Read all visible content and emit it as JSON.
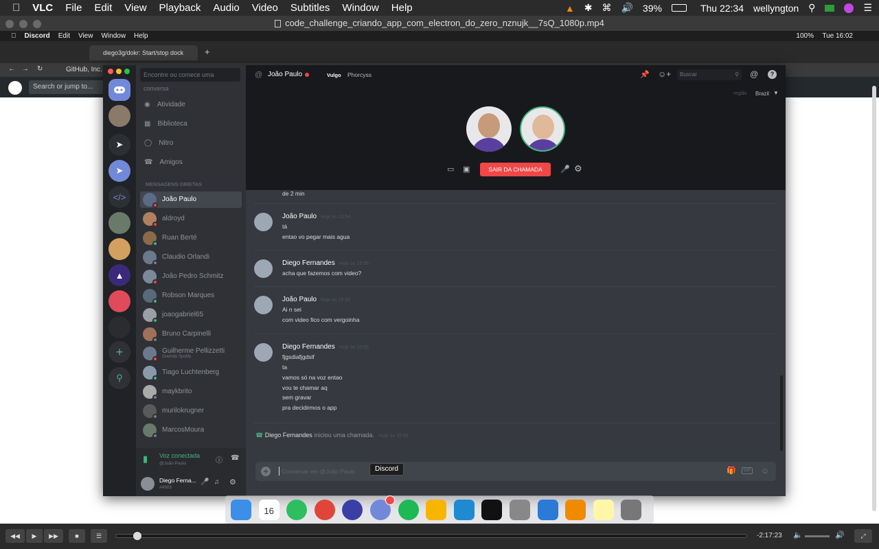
{
  "vlc": {
    "app": "VLC",
    "menus": [
      "File",
      "Edit",
      "View",
      "Playback",
      "Audio",
      "Video",
      "Subtitles",
      "Window",
      "Help"
    ],
    "battery": "39%",
    "datetime": "Thu 22:34",
    "user": "wellyngton",
    "file_title": "code_challenge_criando_app_com_electron_do_zero_nznujk__7sQ_1080p.mp4",
    "time_remaining": "-2:17:23"
  },
  "inner": {
    "app": "Discord",
    "menus": [
      "Edit",
      "View",
      "Window",
      "Help"
    ],
    "battery": "100%",
    "clock": "Tue 16:02",
    "tab_title": "diego3g/dokr: Start/stop dock",
    "address": "GitHub, Inc.",
    "gh_search": "Search or jump to..."
  },
  "dm": {
    "search_placeholder": "Encontre ou comece uma conversa",
    "nav": [
      "Atividade",
      "Biblioteca",
      "Nitro",
      "Amigos"
    ],
    "section_title": "MENSAGENS DIRETAS",
    "users": [
      {
        "name": "João Paulo",
        "status": "#f04747",
        "color": "#5b6a86"
      },
      {
        "name": "aldroyd",
        "status": "#f04747",
        "color": "#b08060"
      },
      {
        "name": "Ruan Berté",
        "status": "#43b581",
        "color": "#8a6a4a"
      },
      {
        "name": "Claudio Orlandi",
        "status": "#747f8d",
        "color": "#6a7a8a"
      },
      {
        "name": "João Pedro Schmitz",
        "status": "#f04747",
        "color": "#7a8a9a"
      },
      {
        "name": "Robson Marques",
        "status": "#43b581",
        "color": "#5a6a7a"
      },
      {
        "name": "joaogabriel65",
        "status": "#43b581",
        "color": "#9aa0a6"
      },
      {
        "name": "Bruno Carpinelli",
        "status": "#747f8d",
        "color": "#a0705a"
      },
      {
        "name": "Guilherme Pellizzetti",
        "sub": "Ouvindo Spotify",
        "status": "#f04747",
        "color": "#6a7a8a"
      },
      {
        "name": "Tiago Luchtenberg",
        "status": "#43b581",
        "color": "#8a9aaa"
      },
      {
        "name": "maykbrito",
        "status": "#747f8d",
        "color": "#aaaaaa"
      },
      {
        "name": "murilokrugner",
        "status": "#747f8d",
        "color": "#5a5a5a"
      },
      {
        "name": "MarcosMoura",
        "status": "#747f8d",
        "color": "#6a7a6a"
      }
    ],
    "voice_status": "Voz conectada",
    "voice_sub": "@João Paulo",
    "me_name": "Diego Ferna...",
    "me_tag": "#4903"
  },
  "chat": {
    "header_name": "João Paulo",
    "vulgo": "Vulgo",
    "nick": "Phorcyss",
    "search": "Buscar",
    "region_label": "região",
    "region": "Brazil",
    "leave_call": "SAIR DA CHAMADA",
    "partial_top": "de 2 min",
    "messages": [
      {
        "author": "João Paulo",
        "time": "Hoje às 15:54",
        "lines": [
          "tá",
          "entao vo pegar mais agua"
        ]
      },
      {
        "author": "Diego Fernandes",
        "time": "Hoje às 15:55",
        "lines": [
          "acha que fazemos com video?"
        ]
      },
      {
        "author": "João Paulo",
        "time": "Hoje às 15:55",
        "lines": [
          "Ai n sei",
          "com video fico com vergoinha"
        ]
      },
      {
        "author": "Diego Fernandes",
        "time": "Hoje às 15:55",
        "lines": [
          "fjgsdiafjgdsif",
          "ta",
          "vamos só na voz entao",
          "vou te chamar aq",
          "sem gravar",
          "pra decidirmos o app"
        ]
      }
    ],
    "call_author": "Diego Fernandes",
    "call_text": "iniciou uma chamada.",
    "call_time": "Hoje às 15:56",
    "composer_placeholder": "Conversar em @João Paulo"
  },
  "dock": {
    "tooltip": "Discord",
    "badge": "",
    "icons": [
      {
        "name": "finder",
        "color": "#3b8fe6"
      },
      {
        "name": "calendar",
        "color": "#ffffff",
        "label": "16"
      },
      {
        "name": "evernote",
        "color": "#2dbe60"
      },
      {
        "name": "chrome",
        "color": "#e0453a"
      },
      {
        "name": "alto",
        "color": "#3a3fa8"
      },
      {
        "name": "discord",
        "color": "#7289da"
      },
      {
        "name": "spotify",
        "color": "#1db954"
      },
      {
        "name": "sketch",
        "color": "#f7b500"
      },
      {
        "name": "vscode",
        "color": "#1f8ad2"
      },
      {
        "name": "terminal",
        "color": "#111111"
      },
      {
        "name": "photos",
        "color": "#888888"
      },
      {
        "name": "xcode-app",
        "color": "#2a7ad6"
      },
      {
        "name": "vlc",
        "color": "#f08a00"
      },
      {
        "name": "notes",
        "color": "#fff6a8"
      },
      {
        "name": "trash",
        "color": "#777777"
      }
    ]
  }
}
